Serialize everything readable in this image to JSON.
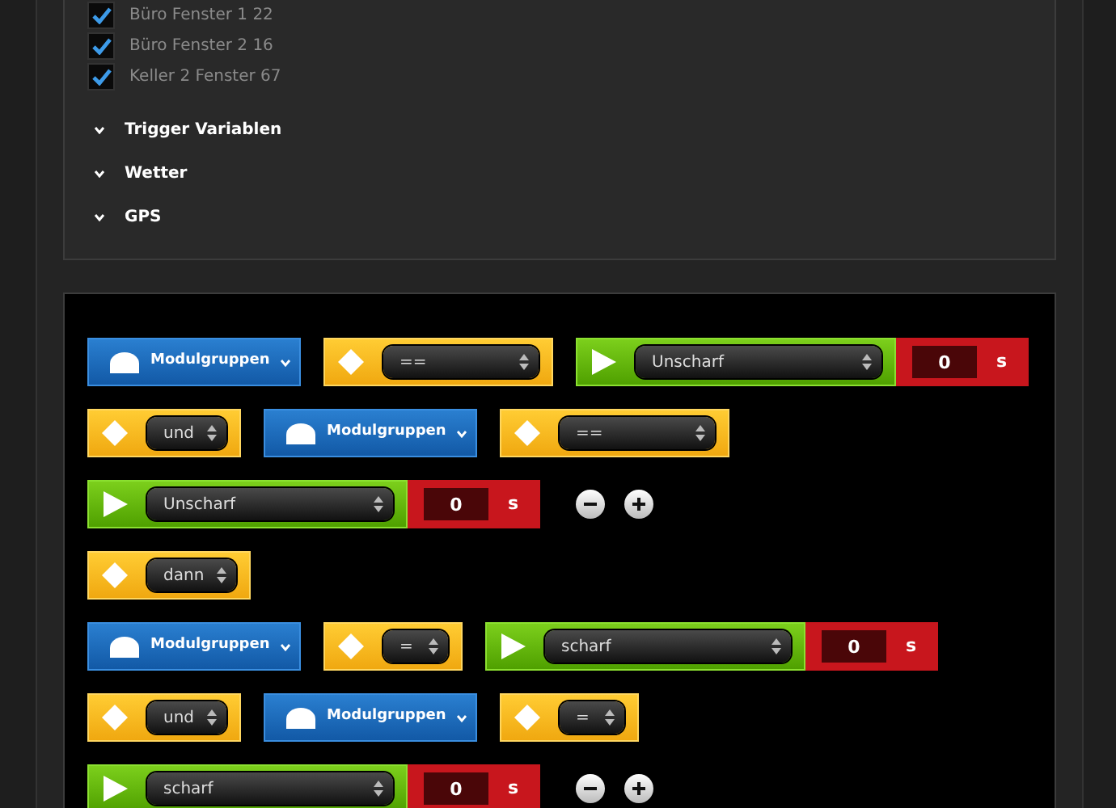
{
  "filter_panel": {
    "items": [
      {
        "kind": "checkbox",
        "label": "Büro Fenster 1 22",
        "checked": true
      },
      {
        "kind": "checkbox",
        "label": "Büro Fenster 2 16",
        "checked": true
      },
      {
        "kind": "checkbox",
        "label": "Keller 2 Fenster 67",
        "checked": true
      },
      {
        "kind": "section",
        "label": "Trigger Variablen",
        "expanded": false
      },
      {
        "kind": "section",
        "label": "Wetter",
        "expanded": false
      },
      {
        "kind": "section",
        "label": "GPS",
        "expanded": false
      }
    ]
  },
  "rule_editor": {
    "rows": [
      [
        {
          "kind": "module",
          "label": "Modulgruppen"
        },
        {
          "kind": "operator",
          "value": "=="
        },
        {
          "kind": "state",
          "value": "Unscharf",
          "time": "0",
          "unit": "s"
        }
      ],
      [
        {
          "kind": "operator",
          "value": "und"
        },
        {
          "kind": "module",
          "label": "Modulgruppen"
        },
        {
          "kind": "operator",
          "value": "=="
        }
      ],
      [
        {
          "kind": "state",
          "value": "Unscharf",
          "time": "0",
          "unit": "s"
        },
        {
          "kind": "controls"
        }
      ],
      [
        {
          "kind": "operator",
          "value": "dann"
        }
      ],
      [
        {
          "kind": "module",
          "label": "Modulgruppen"
        },
        {
          "kind": "operator",
          "value": "="
        },
        {
          "kind": "state",
          "value": "scharf",
          "time": "0",
          "unit": "s"
        }
      ],
      [
        {
          "kind": "operator",
          "value": "und"
        },
        {
          "kind": "module",
          "label": "Modulgruppen"
        },
        {
          "kind": "operator",
          "value": "="
        }
      ],
      [
        {
          "kind": "state",
          "value": "scharf",
          "time": "0",
          "unit": "s"
        },
        {
          "kind": "controls"
        }
      ]
    ]
  }
}
